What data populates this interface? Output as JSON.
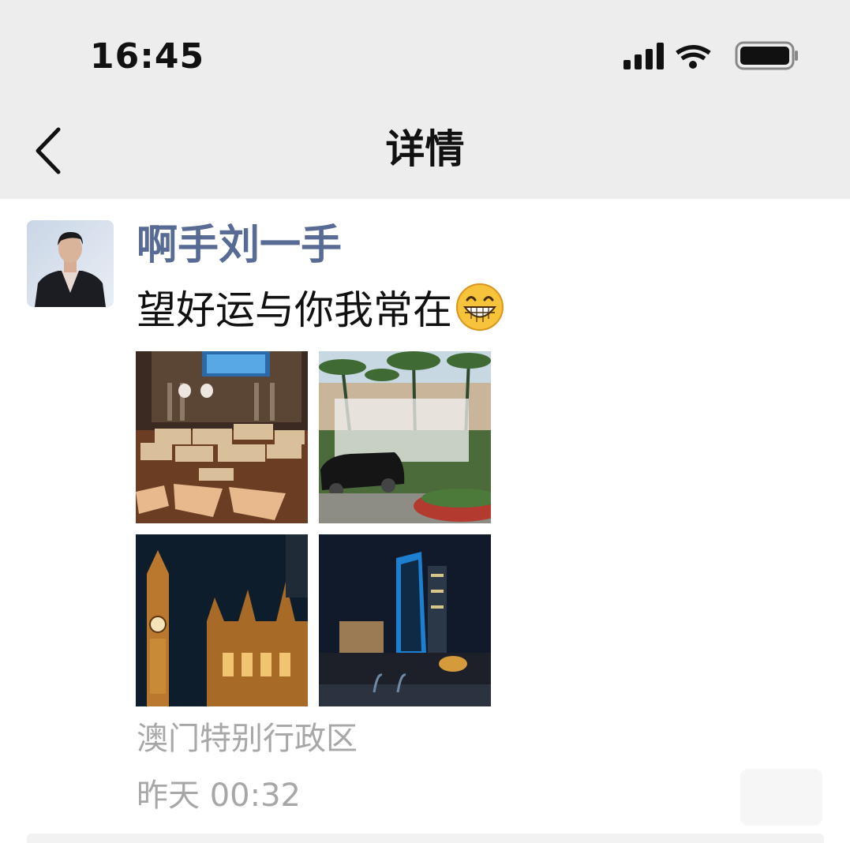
{
  "status_bar": {
    "time": "16:45",
    "icons": [
      "signal-icon",
      "wifi-icon",
      "battery-icon"
    ]
  },
  "nav": {
    "back_icon": "chevron-left-icon",
    "title": "详情"
  },
  "post": {
    "username": "啊手刘一手",
    "caption": "望好运与你我常在",
    "caption_emoji": "grinning-emoji-icon",
    "photos": [
      {
        "name": "photo-cash-on-table"
      },
      {
        "name": "photo-car-palm-trees"
      },
      {
        "name": "photo-clock-tower-night"
      },
      {
        "name": "photo-blue-tower-night"
      }
    ],
    "location": "澳门特别行政区",
    "timestamp": "昨天 00:32"
  },
  "colors": {
    "username": "#576b95",
    "secondary_text": "#a7a7a7",
    "header_bg": "#ededed"
  }
}
